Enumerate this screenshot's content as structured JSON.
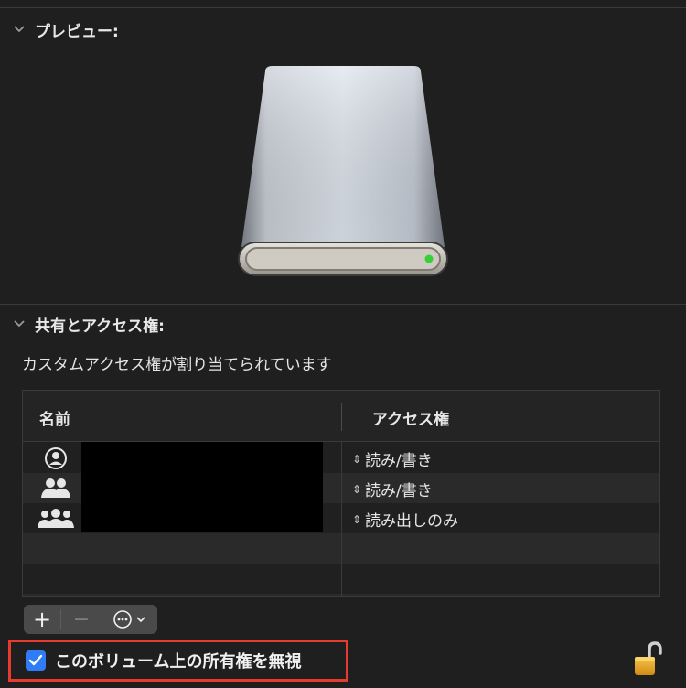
{
  "preview": {
    "title": "プレビュー:"
  },
  "sharing": {
    "title": "共有とアクセス権:",
    "subtitle": "カスタムアクセス権が割り当てられています",
    "columns": {
      "name": "名前",
      "access": "アクセス権"
    },
    "rows": [
      {
        "icon": "single-user-icon",
        "access": "読み/書き"
      },
      {
        "icon": "user-group-icon",
        "access": "読み/書き"
      },
      {
        "icon": "everyone-icon",
        "access": "読み出しのみ"
      }
    ]
  },
  "toolbar": {
    "add": "+",
    "remove": "−"
  },
  "ignore_ownership": {
    "label": "このボリューム上の所有権を無視",
    "checked": true
  },
  "colors": {
    "accent": "#2f7cf6",
    "highlight_border": "#e63b2e",
    "status_led": "#38d038"
  }
}
